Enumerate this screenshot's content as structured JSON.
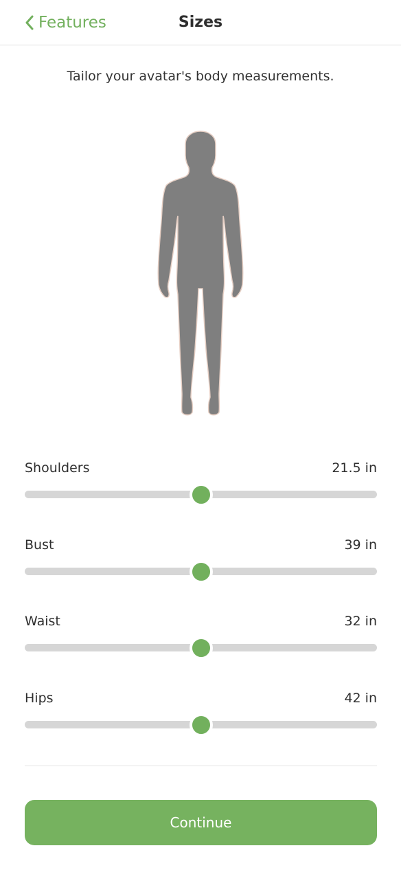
{
  "header": {
    "back_label": "Features",
    "title": "Sizes",
    "back_icon": "chevron-left-icon"
  },
  "subtitle": "Tailor your avatar's body measurements.",
  "colors": {
    "accent": "#72b05d",
    "track": "#d6d6d6",
    "avatar_fill": "#7f7f7f"
  },
  "sliders": [
    {
      "label": "Shoulders",
      "value": "21.5 in",
      "level": 0.5
    },
    {
      "label": "Bust",
      "value": "39 in",
      "level": 0.5
    },
    {
      "label": "Waist",
      "value": "32 in",
      "level": 0.5
    },
    {
      "label": "Hips",
      "value": "42 in",
      "level": 0.5
    }
  ],
  "continue_label": "Continue"
}
